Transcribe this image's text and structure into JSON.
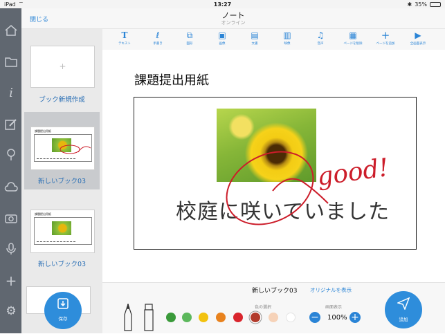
{
  "statusbar": {
    "device": "iPad",
    "time": "13:27",
    "battery": "35%"
  },
  "header": {
    "close_label": "閉じる",
    "title": "ノート",
    "subtitle": "オンライン"
  },
  "sidebar": {
    "new_book_label": "ブック新規作成",
    "items": [
      {
        "label": "新しいブック03",
        "title": "課題提出用紙"
      },
      {
        "label": "新しいブック03",
        "title": "課題提出用紙"
      }
    ],
    "save_label": "保存"
  },
  "toolbar": {
    "tools": [
      {
        "icon": "text-icon",
        "label": "テキスト"
      },
      {
        "icon": "pen-icon",
        "label": "手書き"
      },
      {
        "icon": "shape-icon",
        "label": "図形"
      },
      {
        "icon": "image-icon",
        "label": "画像"
      },
      {
        "icon": "document-icon",
        "label": "文書"
      },
      {
        "icon": "video-icon",
        "label": "映像"
      },
      {
        "icon": "audio-icon",
        "label": "音声"
      },
      {
        "icon": "trash-icon",
        "label": "ページを削除"
      },
      {
        "icon": "plus-icon",
        "label": "ページを追加"
      },
      {
        "icon": "play-icon",
        "label": "全画面表示"
      }
    ]
  },
  "page": {
    "title": "課題提出用紙",
    "handwriting": "校庭に咲いていました",
    "annotation": "good!"
  },
  "bottom": {
    "book_name": "新しいブック03",
    "show_original": "オリジナルを表示",
    "color_label": "色の選択",
    "zoom_label": "画面表示",
    "zoom_value": "100%",
    "add_label": "追加"
  },
  "colors": {
    "accent": "#2a84d6",
    "palette": [
      "#3a9a3a",
      "#5cb85c",
      "#f2c20f",
      "#e8821e",
      "#d9252d",
      "#b23b2c",
      "#f6d2b8",
      "#ffffff"
    ],
    "ink_red": "#cc1d2a"
  }
}
